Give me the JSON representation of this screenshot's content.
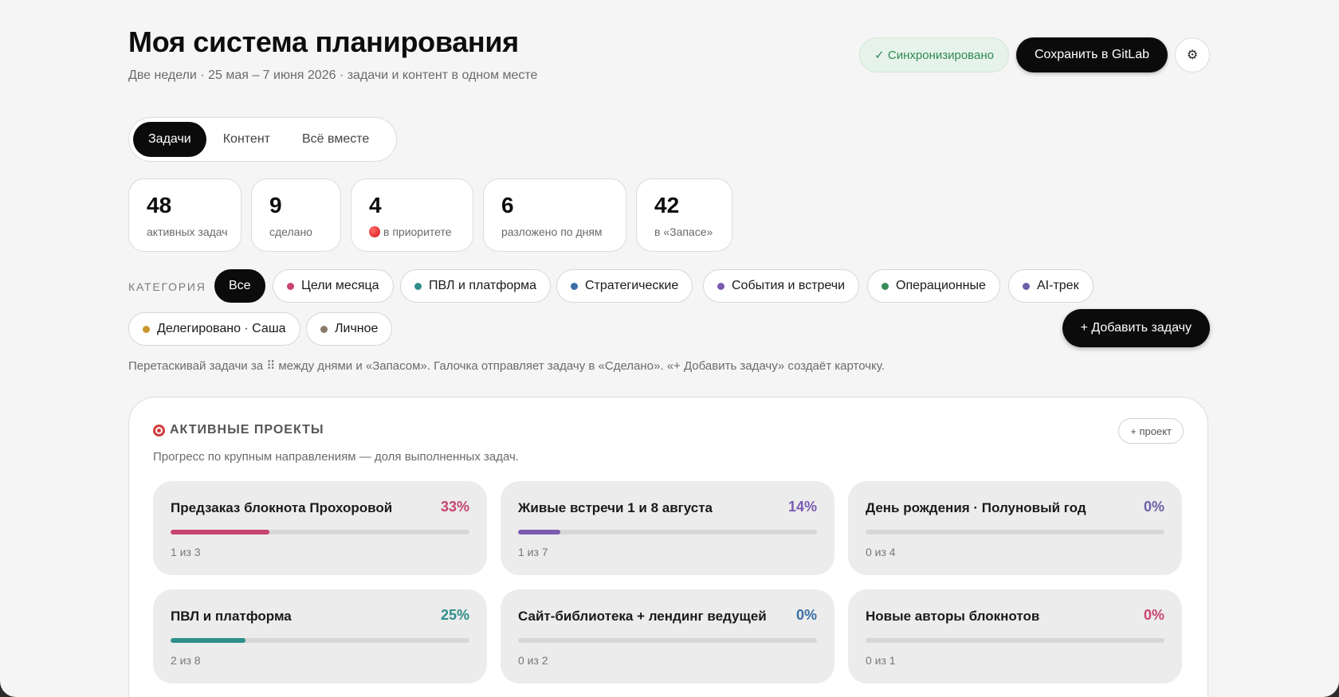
{
  "header": {
    "title": "Моя система планирования",
    "subtitle": "Две недели · 25 мая – 7 июня 2026 · задачи и контент в одном месте",
    "sync_label": "✓ Синхронизировано",
    "save_label": "Сохранить в GitLab",
    "settings_icon": "⚙"
  },
  "tabs": [
    {
      "label": "Задачи",
      "active": true
    },
    {
      "label": "Контент",
      "active": false
    },
    {
      "label": "Всё вместе",
      "active": false
    }
  ],
  "stats": [
    {
      "value": "48",
      "label": "активных задач"
    },
    {
      "value": "9",
      "label": "сделано"
    },
    {
      "value": "4",
      "label": "в приоритете",
      "icon": "red-circle-icon"
    },
    {
      "value": "6",
      "label": "разложено по дням"
    },
    {
      "value": "42",
      "label": "в «Запасе»"
    }
  ],
  "categories": {
    "label": "КАТЕГОРИЯ",
    "items": [
      {
        "label": "Все",
        "active": true
      },
      {
        "label": "Цели месяца",
        "color": "#c8446e"
      },
      {
        "label": "ПВЛ и платформа",
        "color": "#2f8f8b"
      },
      {
        "label": "Стратегические",
        "color": "#3a6ea5"
      },
      {
        "label": "События и встречи",
        "color": "#7b5bb0"
      },
      {
        "label": "Операционные",
        "color": "#3a8a5c"
      },
      {
        "label": "AI-трек",
        "color": "#6a5fa8"
      },
      {
        "label": "Делегировано · Саша",
        "color": "#c8952e"
      },
      {
        "label": "Личное",
        "color": "#8a7a68"
      }
    ],
    "add_task_label": "+ Добавить задачу"
  },
  "hint": "Перетаскивай задачи за ⠿ между днями и «Запасом». Галочка отправляет задачу в «Сделано». «+ Добавить задачу» создаёт карточку.",
  "projects": {
    "title": "АКТИВНЫЕ ПРОЕКТЫ",
    "add_label": "+ проект",
    "description": "Прогресс по крупным направлениям — доля выполненных задач.",
    "cards": [
      {
        "title": "Предзаказ блокнота Прохоровой",
        "percent": "33%",
        "progress": 0.33,
        "count": "1 из 3",
        "color": "#c8446e"
      },
      {
        "title": "Живые встречи 1 и 8 августа",
        "percent": "14%",
        "progress": 0.14,
        "count": "1 из 7",
        "color": "#7b5bb0"
      },
      {
        "title": "День рождения · Полуновый год",
        "percent": "0%",
        "progress": 0,
        "count": "0 из 4",
        "color": "#6a5fa8"
      },
      {
        "title": "ПВЛ и платформа",
        "percent": "25%",
        "progress": 0.25,
        "count": "2 из 8",
        "color": "#2f8f8b"
      },
      {
        "title": "Сайт-библиотека + лендинг ведущей",
        "percent": "0%",
        "progress": 0,
        "count": "0 из 2",
        "color": "#3a6ea5"
      },
      {
        "title": "Новые авторы блокнотов",
        "percent": "0%",
        "progress": 0,
        "count": "0 из 1",
        "color": "#c8446e"
      }
    ]
  }
}
